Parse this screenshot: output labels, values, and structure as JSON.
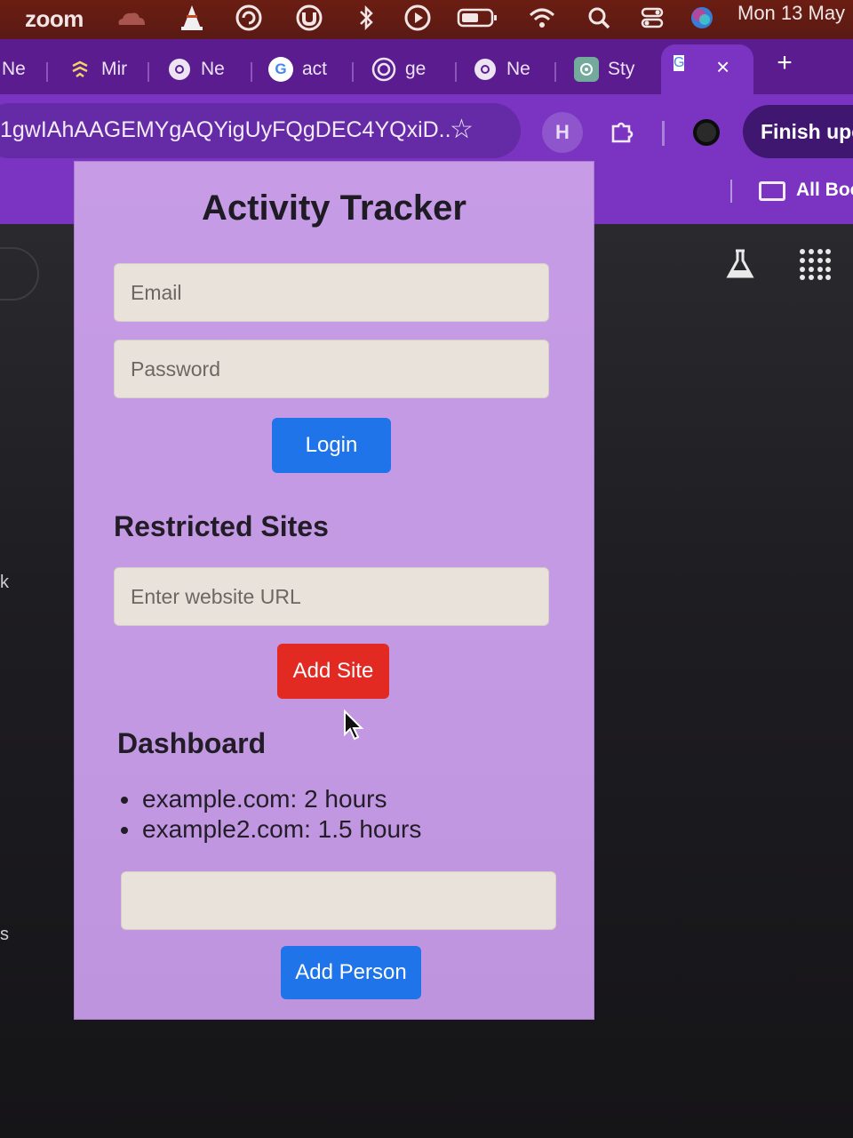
{
  "menubar": {
    "app_name": "zoom",
    "icons": [
      "cloudflare-icon",
      "vlc-icon",
      "refresh-circle-icon",
      "utorrent-icon",
      "bluetooth-icon",
      "play-circle-icon",
      "battery-icon",
      "wifi-icon",
      "search-icon",
      "control-center-icon",
      "siri-icon"
    ],
    "clock": "Mon 13 May"
  },
  "browser": {
    "tabs": [
      {
        "label": "Ne",
        "icon": "none"
      },
      {
        "label": "Mir",
        "icon": "fluent-icon"
      },
      {
        "label": "Ne",
        "icon": "chrome-icon"
      },
      {
        "label": "act",
        "icon": "google-icon"
      },
      {
        "label": "ge",
        "icon": "gemini-icon"
      },
      {
        "label": "Ne",
        "icon": "chrome-icon"
      },
      {
        "label": "Sty",
        "icon": "chatgpt-icon"
      }
    ],
    "active_tab_icon": "google-icon",
    "close_glyph": "×",
    "new_tab_glyph": "+",
    "address_url": "1gwIAhAAGEMYgAQYigUyFQgDEC4YQxiD...",
    "extension_h_label": "H",
    "finish_update_label": "Finish upc",
    "bookmarks_label": "All Boo"
  },
  "page_edges": {
    "k_label": "k",
    "s_label": "s"
  },
  "popup": {
    "title": "Activity Tracker",
    "email_placeholder": "Email",
    "password_placeholder": "Password",
    "login_label": "Login",
    "restricted_heading": "Restricted Sites",
    "url_placeholder": "Enter website URL",
    "add_site_label": "Add Site",
    "dashboard_heading": "Dashboard",
    "dashboard_items": [
      "example.com: 2 hours",
      "example2.com: 1.5 hours"
    ],
    "person_input_value": "",
    "add_person_label": "Add Person"
  },
  "colors": {
    "menubar": "#5a1a14",
    "tabstrip": "#5a1c8e",
    "toolbar": "#7b34c2",
    "popup_bg": "#c79be6",
    "primary_button": "#1e74e8",
    "danger_button": "#e22a22",
    "input_bg": "#e8e2db"
  }
}
